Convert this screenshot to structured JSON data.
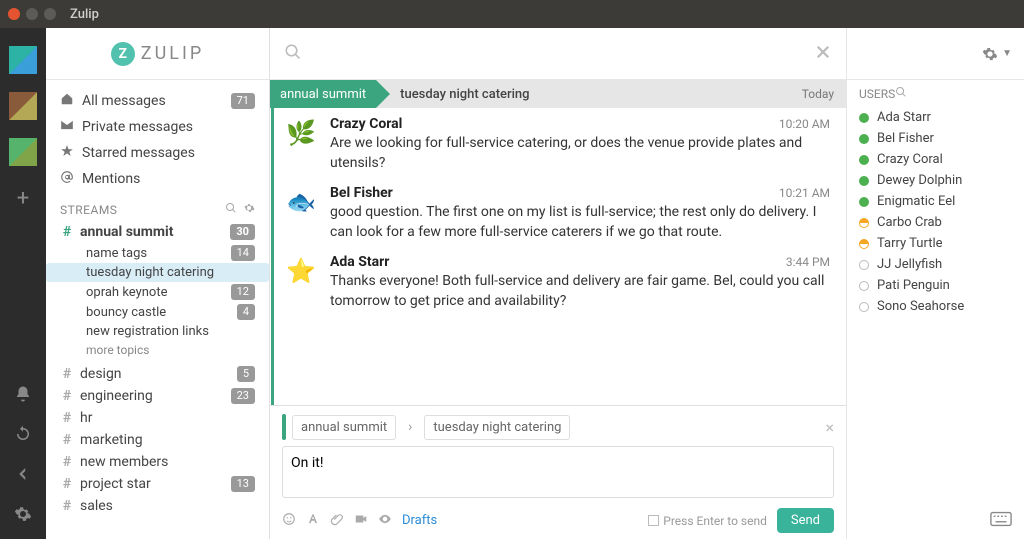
{
  "window": {
    "title": "Zulip"
  },
  "brand": {
    "name": "ZULIP",
    "mark": "Z"
  },
  "nav": {
    "items": [
      {
        "label": "All messages",
        "count": "71"
      },
      {
        "label": "Private messages"
      },
      {
        "label": "Starred messages"
      },
      {
        "label": "Mentions"
      }
    ]
  },
  "streams": {
    "heading": "STREAMS",
    "expanded": {
      "name": "annual summit",
      "count": "30",
      "topics": [
        {
          "label": "name tags",
          "count": "14"
        },
        {
          "label": "tuesday night catering",
          "selected": true
        },
        {
          "label": "oprah keynote",
          "count": "12"
        },
        {
          "label": "bouncy castle",
          "count": "4"
        },
        {
          "label": "new registration links"
        }
      ],
      "more": "more topics"
    },
    "others": [
      {
        "name": "design",
        "count": "5"
      },
      {
        "name": "engineering",
        "count": "23"
      },
      {
        "name": "hr"
      },
      {
        "name": "marketing"
      },
      {
        "name": "new members"
      },
      {
        "name": "project star",
        "count": "13"
      },
      {
        "name": "sales"
      }
    ]
  },
  "header": {
    "stream": "annual summit",
    "topic": "tuesday night catering",
    "date": "Today"
  },
  "messages": [
    {
      "sender": "Crazy Coral",
      "time": "10:20 AM",
      "avatar": "🌿",
      "content": "Are we looking for full-service catering, or does the venue provide plates and utensils?"
    },
    {
      "sender": "Bel Fisher",
      "time": "10:21 AM",
      "avatar": "🐟",
      "content": "good question. The first one on my list is full-service; the rest only do delivery. I can look for a few more full-service caterers if we go that route."
    },
    {
      "sender": "Ada Starr",
      "time": "3:44 PM",
      "avatar": "⭐",
      "content": "Thanks everyone! Both full-service and delivery are fair game. Bel, could you call tomorrow to get price and availability?"
    }
  ],
  "compose": {
    "stream": "annual summit",
    "topic": "tuesday night catering",
    "body": "On it!",
    "drafts": "Drafts",
    "enter_hint": "Press Enter to send",
    "send": "Send"
  },
  "users": {
    "heading": "USERS",
    "list": [
      {
        "name": "Ada Starr",
        "presence": "online"
      },
      {
        "name": "Bel Fisher",
        "presence": "online"
      },
      {
        "name": "Crazy Coral",
        "presence": "online"
      },
      {
        "name": "Dewey Dolphin",
        "presence": "online"
      },
      {
        "name": "Enigmatic Eel",
        "presence": "online"
      },
      {
        "name": "Carbo Crab",
        "presence": "idle"
      },
      {
        "name": "Tarry Turtle",
        "presence": "idle"
      },
      {
        "name": "JJ Jellyfish",
        "presence": "offline"
      },
      {
        "name": "Pati Penguin",
        "presence": "offline"
      },
      {
        "name": "Sono Seahorse",
        "presence": "offline"
      }
    ]
  }
}
